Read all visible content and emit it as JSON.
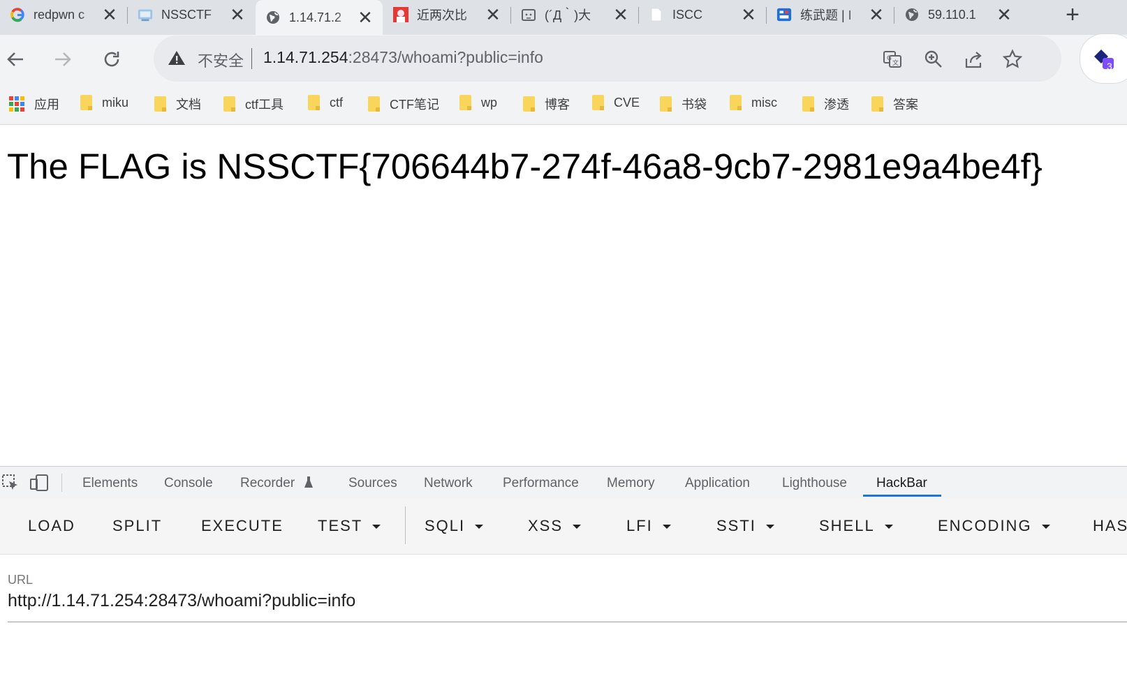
{
  "tabs": [
    {
      "title": "redpwn c",
      "icon": "google-icon"
    },
    {
      "title": "NSSCTF",
      "icon": "nssctf-icon"
    },
    {
      "title": "1.14.71.2",
      "icon": "globe-icon",
      "active": true
    },
    {
      "title": "近两次比",
      "icon": "avatar-icon"
    },
    {
      "title": "(´Д｀)大",
      "icon": "broken-page-icon"
    },
    {
      "title": "ISCC",
      "icon": "page-icon"
    },
    {
      "title": "练武题 | I",
      "icon": "app-icon"
    },
    {
      "title": "59.110.1",
      "icon": "globe-icon"
    }
  ],
  "toolbar": {
    "security_label": "不安全",
    "url_host": "1.14.71.254",
    "url_rest": ":28473/whoami?public=info",
    "extension_badge": "3"
  },
  "bookmarks": [
    {
      "label": "应用",
      "type": "apps"
    },
    {
      "label": "miku"
    },
    {
      "label": "文档"
    },
    {
      "label": "ctf工具"
    },
    {
      "label": "ctf"
    },
    {
      "label": "CTF笔记"
    },
    {
      "label": "wp"
    },
    {
      "label": "博客"
    },
    {
      "label": "CVE"
    },
    {
      "label": "书袋"
    },
    {
      "label": "misc"
    },
    {
      "label": "渗透"
    },
    {
      "label": "答案"
    }
  ],
  "page": {
    "text": "The FLAG is NSSCTF{706644b7-274f-46a8-9cb7-2981e9a4be4f}"
  },
  "devtools": {
    "tabs": [
      "Elements",
      "Console",
      "Recorder",
      "Sources",
      "Network",
      "Performance",
      "Memory",
      "Application",
      "Lighthouse",
      "HackBar"
    ],
    "active_tab": "HackBar"
  },
  "hackbar": {
    "buttons": [
      "LOAD",
      "SPLIT",
      "EXECUTE",
      "TEST",
      "SQLI",
      "XSS",
      "LFI",
      "SSTI",
      "SHELL",
      "ENCODING",
      "HAS"
    ],
    "url_label": "URL",
    "url_value": "http://1.14.71.254:28473/whoami?public=info"
  },
  "colors": {
    "accent": "#1a73e8",
    "tabstrip": "#dee1e6",
    "toolbar": "#f1f3f4"
  }
}
